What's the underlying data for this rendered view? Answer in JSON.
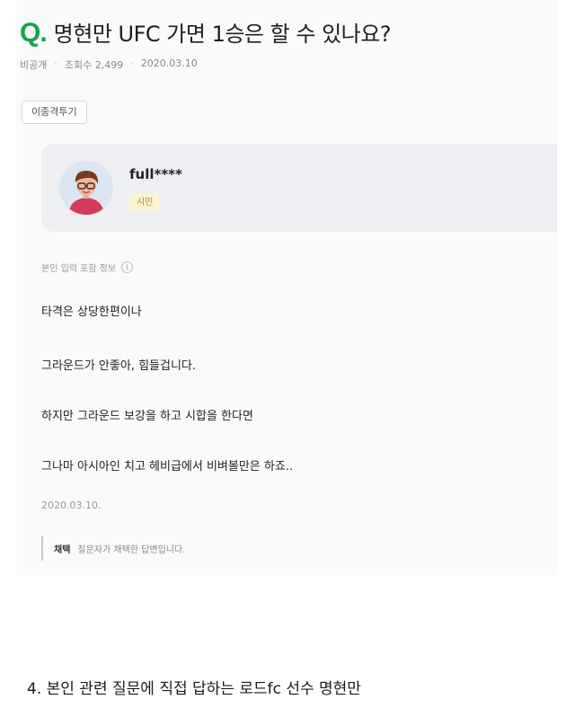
{
  "question": {
    "mark": "Q.",
    "title": "명현만 UFC 가면 1승은 할 수 있나요?",
    "visibility": "비공개",
    "views": "조회수 2,499",
    "date": "2020.03.10",
    "tag": "이종격투기"
  },
  "answer": {
    "username": "full****",
    "badge": "시민",
    "info_label": "본인 입력 포함 정보",
    "info_icon": "i",
    "lines": [
      "타격은 상당한편이나",
      "그라운드가 안좋아, 힘들겁니다.",
      "하지만 그라운드 보강을 하고 시합을 한다면",
      "그나마 아시아인 치고 헤비급에서 비벼볼만은 하죠.."
    ],
    "date": "2020.03.10.",
    "adopted_label": "채택",
    "adopted_desc": "질문자가 채택한 답변입니다."
  },
  "caption": "4. 본인 관련 질문에 직접 답하는 로드fc 선수 명현만",
  "colors": {
    "accent_green": "#14a44d",
    "badge_bg": "#fbf3d3",
    "badge_text": "#b68c20"
  }
}
